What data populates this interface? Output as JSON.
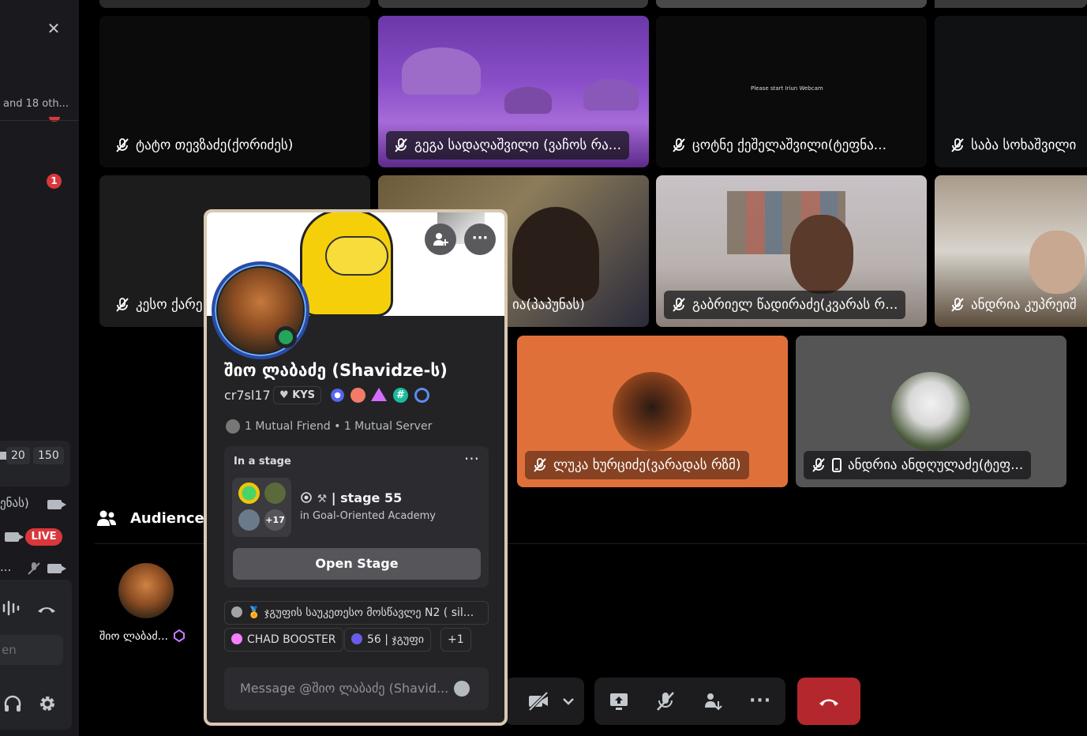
{
  "sidebar": {
    "others_text": "and 18 oth...",
    "unread_badge": "1",
    "count_a": "20",
    "count_b": "150",
    "row1_text": "ენას)",
    "live_label": "LIVE",
    "row3_text": "...",
    "input_placeholder": "en"
  },
  "tiles": [
    {
      "name": "ტატო თევზაძე(ქორიძეს)"
    },
    {
      "name": "გეგა სადაღაშვილი (ვაჩოს რა..."
    },
    {
      "name": "ცოტნე ქეშელაშვილი(ტეფნა...",
      "screen_text": "Please start Iriun Webcam"
    },
    {
      "name": "საბა სოხაშვილი"
    },
    {
      "name": "კესო ქარე"
    },
    {
      "name": "ია(პაპუნას)"
    },
    {
      "name": "გაბრიელ წადირაძე(კვარას რ..."
    },
    {
      "name": "ანდრია კუპრეიშ"
    },
    {
      "name": "ლუკა ხურციძე(ვარადას რზმ)"
    },
    {
      "name": "ანდრია ანდღულაძე(ტეფ..."
    }
  ],
  "popup": {
    "display_name": "შიო ლაბაძე (Shavidze-ს)",
    "username": "cr7sl17",
    "tag": "KYS",
    "mutual_friends": "1 Mutual Friend",
    "mutual_servers": "1 Mutual Server",
    "card_title": "In a stage",
    "stage_name": "| stage 55",
    "stage_server": "in Goal-Oriented Academy",
    "plus_count": "+17",
    "open_button": "Open Stage",
    "roles": [
      "ჯგუფის საუკეთესო მოსწავლე N2 ( sil...",
      "CHAD BOOSTER",
      "56 | ჯგუფი",
      "+1"
    ],
    "message_placeholder": "Message @შიო ლაბაძე (Shavid..."
  },
  "audience": {
    "title": "Audience -",
    "member_name": "შიო ლაბაძ..."
  },
  "colors": {
    "orange_tile": "#e0703a",
    "gray_tile": "#555555",
    "purple_tile": "#6a38a8",
    "hangup": "#b4282d",
    "online": "#23a55a",
    "live": "#da373c"
  },
  "icons": [
    "close-icon",
    "mic-off-icon",
    "camera-icon",
    "add-friend-icon",
    "more-icon",
    "headphones-icon",
    "gear-icon",
    "hang-up-icon",
    "screen-share-icon",
    "activity-icon",
    "emoji-icon",
    "people-icon",
    "phone-icon"
  ]
}
